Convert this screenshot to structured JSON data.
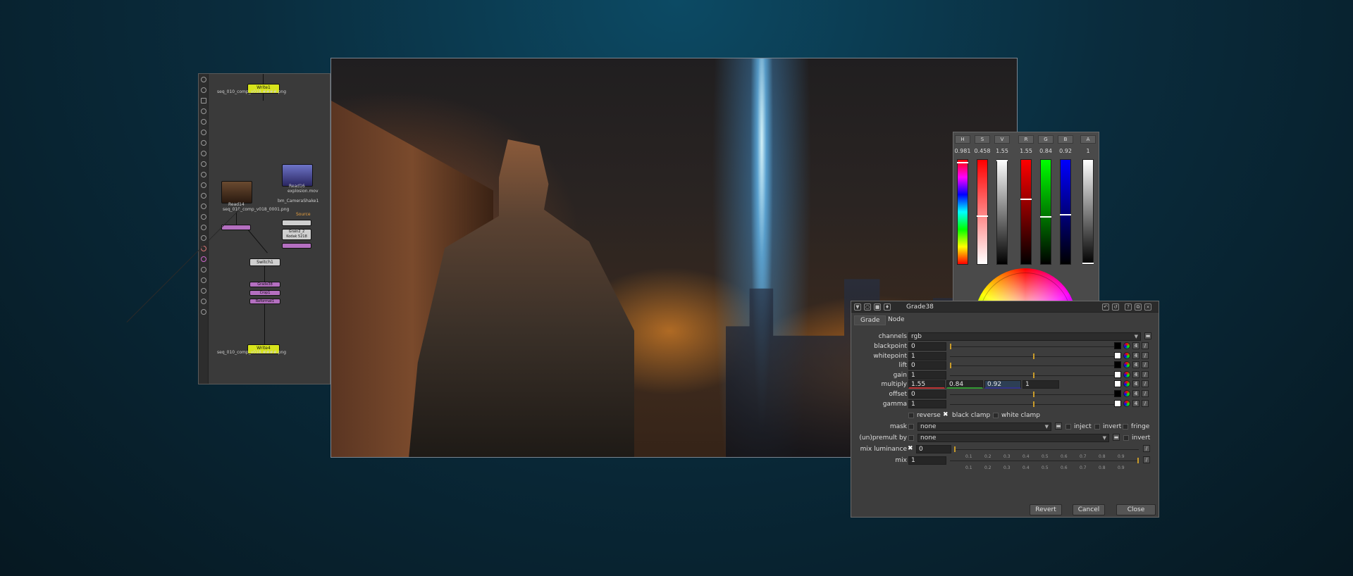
{
  "node_graph": {
    "nodes": [
      {
        "name": "Write1",
        "label": "Write1",
        "sub": "seq_010_comp_v018.####.png"
      },
      {
        "name": "Read14",
        "label": "Read14",
        "sub": "seq_010_comp_v018_0001.png"
      },
      {
        "name": "Read16",
        "label": "Read16",
        "sub": "explosion.mov"
      },
      {
        "name": "bm_CameraShake1",
        "label": "bm_CameraShake1",
        "sub": "Source"
      },
      {
        "name": "Grain2",
        "label": "Grain2_2",
        "sub": "Kodak 5218"
      },
      {
        "name": "Switch1",
        "label": "Switch1",
        "sub": ""
      },
      {
        "name": "Grade38",
        "label": "Grade38",
        "sub": ""
      },
      {
        "name": "Crop1",
        "label": "Crop1",
        "sub": ""
      },
      {
        "name": "Reformat1",
        "label": "Reformat1",
        "sub": ""
      },
      {
        "name": "Write4",
        "label": "Write4",
        "sub": "seq_010_comp_v018.####.png"
      }
    ]
  },
  "color_picker": {
    "channels": [
      {
        "btn": "H",
        "value": "0.981",
        "level": 0.981
      },
      {
        "btn": "S",
        "value": "0.458",
        "level": 0.458
      },
      {
        "btn": "V",
        "value": "1.55",
        "level": 1.0
      },
      {
        "btn": "R",
        "value": "1.55",
        "level": 0.62
      },
      {
        "btn": "G",
        "value": "0.84",
        "level": 0.45
      },
      {
        "btn": "B",
        "value": "0.92",
        "level": 0.47
      },
      {
        "btn": "A",
        "value": "1",
        "level": 0
      }
    ]
  },
  "grade": {
    "title": "Grade38",
    "tabs": [
      "Grade",
      "Node"
    ],
    "channels": {
      "label": "channels",
      "value": "rgb"
    },
    "rows": [
      {
        "label": "blackpoint",
        "value": "0"
      },
      {
        "label": "whitepoint",
        "value": "1"
      },
      {
        "label": "lift",
        "value": "0"
      },
      {
        "label": "gain",
        "value": "1"
      }
    ],
    "multiply": {
      "label": "multiply",
      "r": "1.55",
      "g": "0.84",
      "b": "0.92",
      "a": "1"
    },
    "offset": {
      "label": "offset",
      "value": "0"
    },
    "gamma": {
      "label": "gamma",
      "value": "1"
    },
    "checks": {
      "reverse": "reverse",
      "black_clamp": "black clamp",
      "white_clamp": "white clamp"
    },
    "mask": {
      "label": "mask",
      "value": "none",
      "inject": "inject",
      "invert": "invert",
      "fringe": "fringe"
    },
    "unpremult": {
      "label": "(un)premult by",
      "value": "none",
      "invert": "invert"
    },
    "mix_luminance": {
      "label": "mix luminance",
      "value": "0"
    },
    "mix": {
      "label": "mix",
      "value": "1"
    },
    "slider_ticks": [
      "0.1",
      "0.2",
      "0.3",
      "0.4",
      "0.5",
      "0.6",
      "0.7",
      "0.8",
      "0.9"
    ],
    "buttons": {
      "revert": "Revert",
      "cancel": "Cancel",
      "close": "Close"
    }
  }
}
